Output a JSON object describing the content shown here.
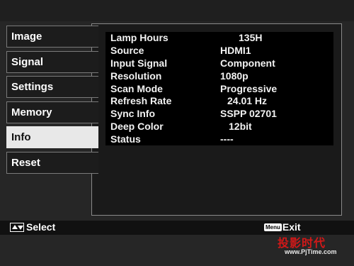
{
  "menu": {
    "items": [
      {
        "label": "Image",
        "active": false
      },
      {
        "label": "Signal",
        "active": false
      },
      {
        "label": "Settings",
        "active": false
      },
      {
        "label": "Memory",
        "active": false
      },
      {
        "label": "Info",
        "active": true
      },
      {
        "label": "Reset",
        "active": false
      }
    ]
  },
  "info": {
    "rows": [
      {
        "label": "Lamp Hours",
        "value": "135H"
      },
      {
        "label": "Source",
        "value": "HDMI1"
      },
      {
        "label": "Input Signal",
        "value": "Component"
      },
      {
        "label": "Resolution",
        "value": "1080p"
      },
      {
        "label": "Scan Mode",
        "value": "Progressive"
      },
      {
        "label": "Refresh Rate",
        "value": "24.01 Hz"
      },
      {
        "label": "Sync Info",
        "value": "SSPP 02701"
      },
      {
        "label": "Deep Color",
        "value": "12bit"
      },
      {
        "label": "Status",
        "value": "----"
      }
    ]
  },
  "footer": {
    "select_label": "Select",
    "menu_key": "Menu",
    "exit_label": "Exit"
  },
  "watermark": {
    "title": "投影时代",
    "url": "www.PjTime.com"
  },
  "colors": {
    "menu_active_bg": "#e8e8e8",
    "panel_bg": "#1a1a1a",
    "watermark_red": "#d21818"
  }
}
